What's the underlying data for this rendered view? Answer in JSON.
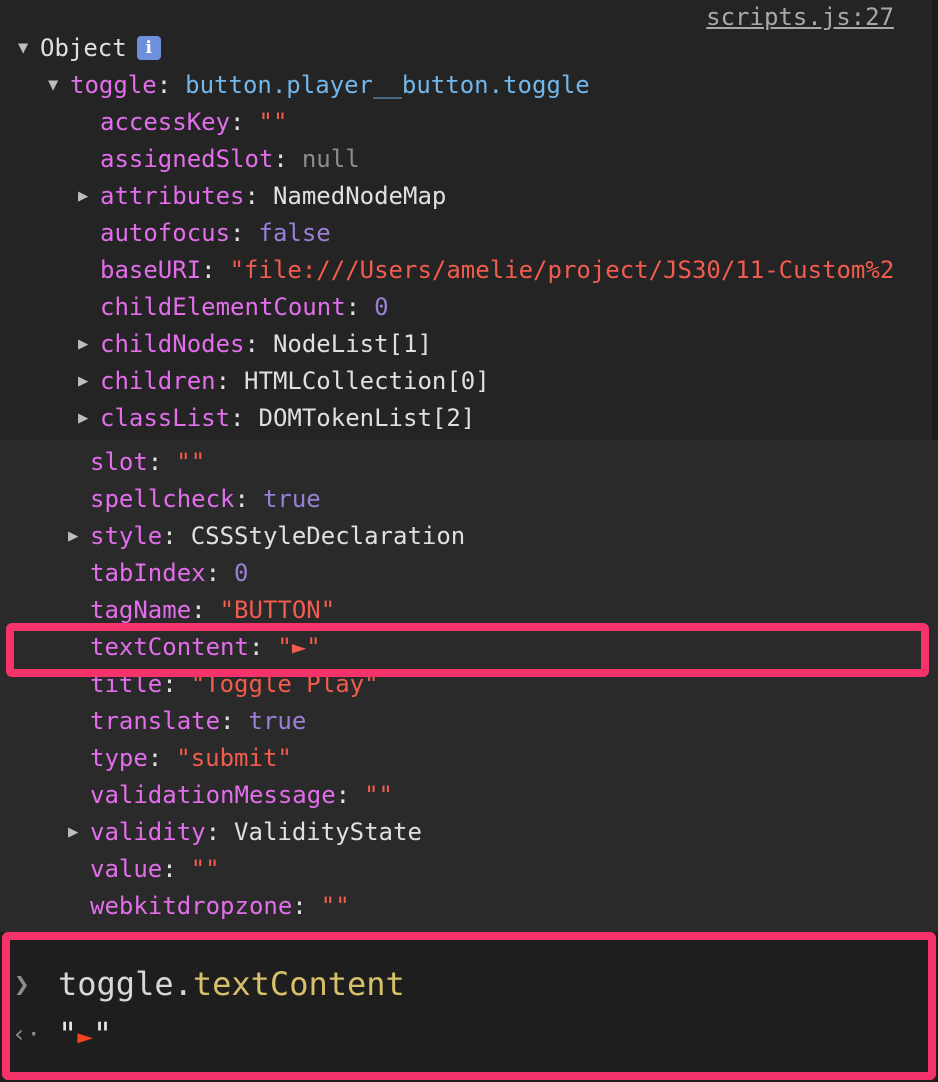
{
  "source_link": "scripts.js:27",
  "header": {
    "object_label": "Object",
    "info_badge": "i"
  },
  "toggle": {
    "key": "toggle",
    "value": "button.player__button.toggle"
  },
  "top_props": [
    {
      "key": "accessKey",
      "value": "\"\"",
      "type": "str"
    },
    {
      "key": "assignedSlot",
      "value": "null",
      "type": "null"
    },
    {
      "key": "attributes",
      "value": "NamedNodeMap",
      "type": "obj",
      "expandable": true
    },
    {
      "key": "autofocus",
      "value": "false",
      "type": "bool"
    },
    {
      "key": "baseURI",
      "value": "\"file:///Users/amelie/project/JS30/11-Custom%2",
      "type": "str"
    },
    {
      "key": "childElementCount",
      "value": "0",
      "type": "num"
    },
    {
      "key": "childNodes",
      "value": "NodeList[1]",
      "type": "obj",
      "expandable": true
    },
    {
      "key": "children",
      "value": "HTMLCollection[0]",
      "type": "obj",
      "expandable": true
    },
    {
      "key": "classList",
      "value": "DOMTokenList[2]",
      "type": "obj",
      "expandable": true
    }
  ],
  "mid_props": [
    {
      "key": "slot",
      "value": "\"\"",
      "type": "str"
    },
    {
      "key": "spellcheck",
      "value": "true",
      "type": "bool"
    },
    {
      "key": "style",
      "value": "CSSStyleDeclaration",
      "type": "obj",
      "expandable": true
    },
    {
      "key": "tabIndex",
      "value": "0",
      "type": "num"
    },
    {
      "key": "tagName",
      "value": "\"BUTTON\"",
      "type": "str"
    },
    {
      "key": "textContent",
      "value": "\"►\"",
      "type": "str"
    },
    {
      "key": "title",
      "value": "\"Toggle Play\"",
      "type": "str"
    },
    {
      "key": "translate",
      "value": "true",
      "type": "bool"
    },
    {
      "key": "type",
      "value": "\"submit\"",
      "type": "str"
    },
    {
      "key": "validationMessage",
      "value": "\"\"",
      "type": "str"
    },
    {
      "key": "validity",
      "value": "ValidityState",
      "type": "obj",
      "expandable": true
    },
    {
      "key": "value",
      "value": "\"\"",
      "type": "str"
    },
    {
      "key": "webkitdropzone",
      "value": "\"\"",
      "type": "str"
    }
  ],
  "console": {
    "prompt_icon": "❯",
    "result_icon": "‹·",
    "input_object": "toggle.",
    "input_property": "textContent",
    "output_quote_open": "\"",
    "output_glyph": "►",
    "output_quote_close": "\""
  },
  "colors": {
    "highlight": "#f5326a",
    "key": "#e36eec",
    "string": "#f15c4e",
    "number_bool": "#9a7fd5",
    "class_name": "#72b6ea",
    "console_property": "#d7c06a"
  }
}
